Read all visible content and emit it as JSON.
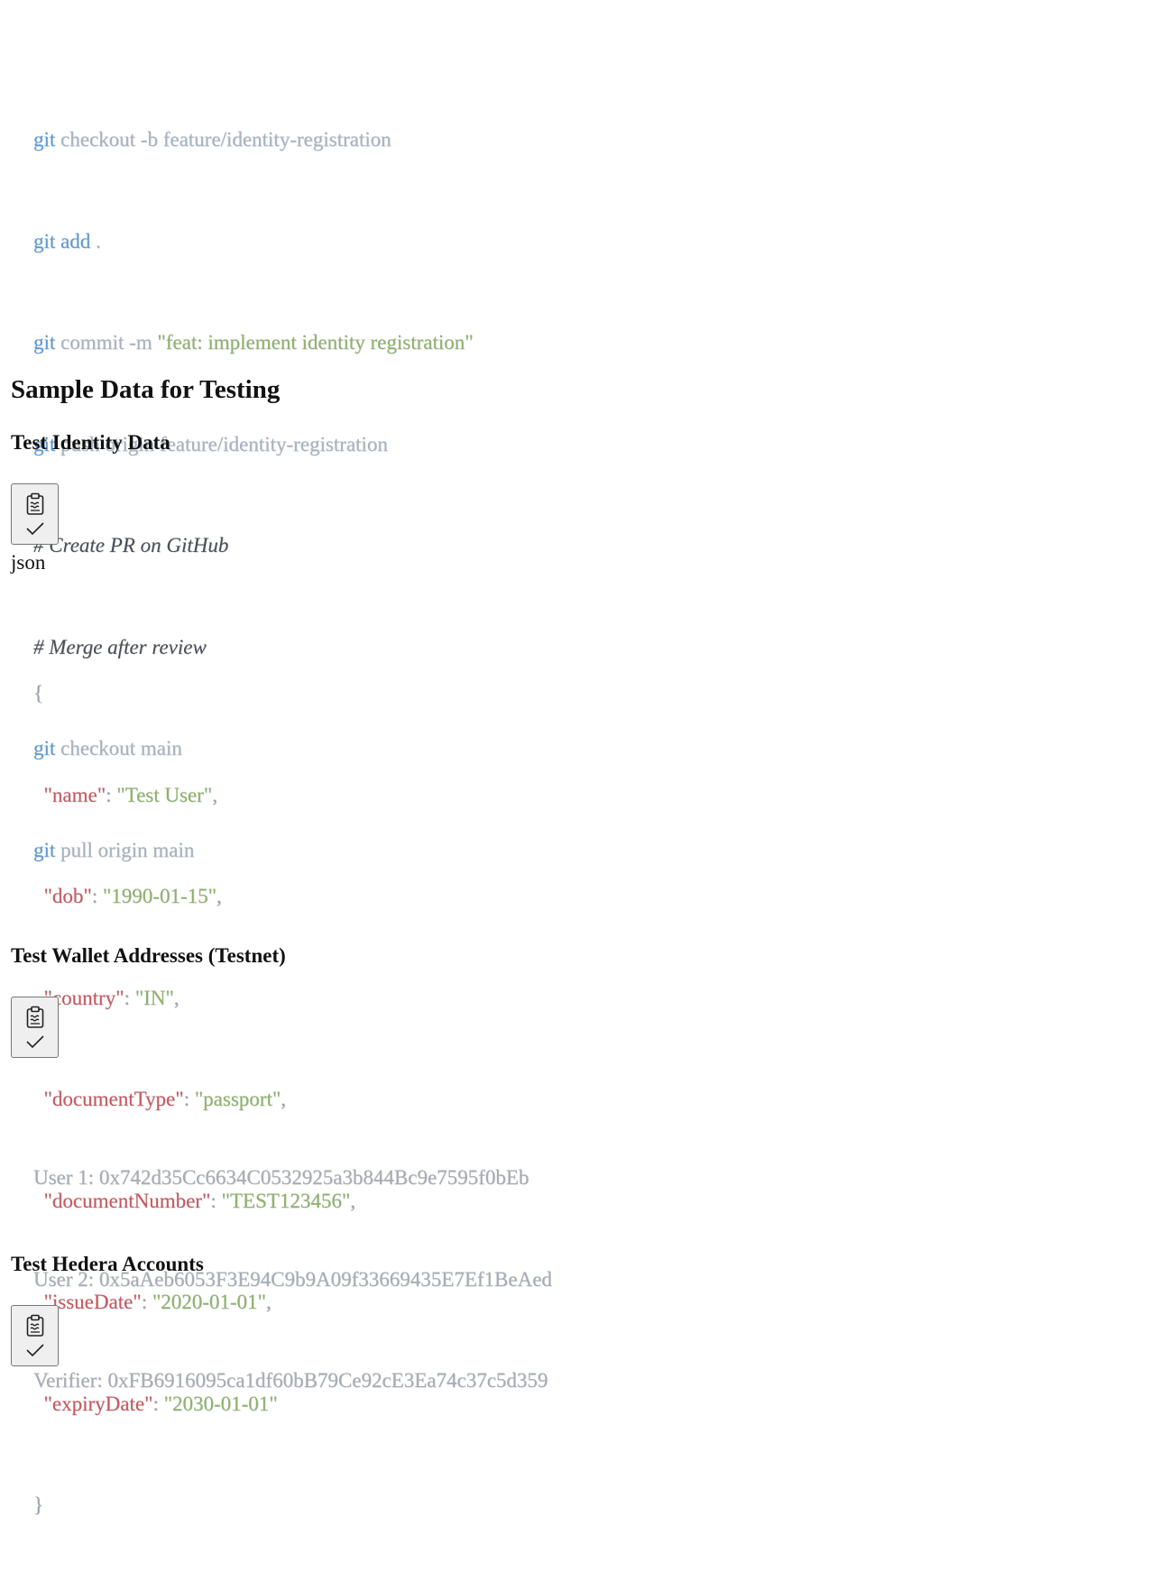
{
  "git_block": {
    "lines": [
      {
        "cmd": "git",
        "rest": " checkout -b feature/identity-registration"
      },
      {
        "cmd": "git add",
        "rest": " ."
      },
      {
        "cmd": "git",
        "rest": " commit -m ",
        "string": "\"feat: implement identity registration\""
      },
      {
        "cmd": "git",
        "rest": " push origin feature/identity-registration"
      },
      {
        "comment": "# Create PR on GitHub"
      },
      {
        "comment": "# Merge after review"
      },
      {
        "cmd": "git",
        "rest": " checkout main"
      },
      {
        "cmd": "git",
        "rest": " pull origin main"
      }
    ]
  },
  "sample_section": {
    "title": "Sample Data for Testing"
  },
  "identity": {
    "title": "Test Identity Data",
    "lang": "json",
    "open_brace": "{",
    "close_brace": "}",
    "fields": [
      {
        "key": "\"name\"",
        "value": "\"Test User\"",
        "sep": ","
      },
      {
        "key": "\"dob\"",
        "value": "\"1990-01-15\"",
        "sep": ","
      },
      {
        "key": "\"country\"",
        "value": "\"IN\"",
        "sep": ","
      },
      {
        "key": "\"documentType\"",
        "value": "\"passport\"",
        "sep": ","
      },
      {
        "key": "\"documentNumber\"",
        "value": "\"TEST123456\"",
        "sep": ","
      },
      {
        "key": "\"issueDate\"",
        "value": "\"2020-01-01\"",
        "sep": ","
      },
      {
        "key": "\"expiryDate\"",
        "value": "\"2030-01-01\"",
        "sep": ""
      }
    ]
  },
  "wallets": {
    "title": "Test Wallet Addresses (Testnet)",
    "lines": [
      "User 1: 0x742d35Cc6634C0532925a3b844Bc9e7595f0bEb",
      "User 2: 0x5aAeb6053F3E94C9b9A09f33669435E7Ef1BeAed",
      "Verifier: 0xFB6916095ca1df60bB79Ce92cE3Ea74c37c5d359"
    ]
  },
  "hedera": {
    "title": "Test Hedera Accounts"
  },
  "icons": {
    "copy": "clipboard-icon",
    "copied": "check-icon"
  }
}
